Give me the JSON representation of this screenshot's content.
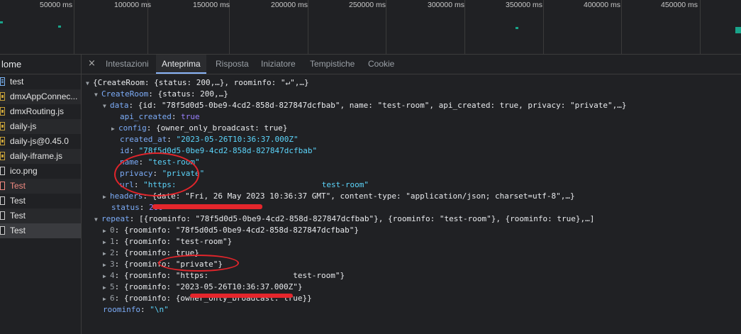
{
  "timeline": {
    "ticks": [
      "50000 ms",
      "100000 ms",
      "150000 ms",
      "200000 ms",
      "250000 ms",
      "300000 ms",
      "350000 ms",
      "400000 ms",
      "450000 ms"
    ]
  },
  "request_list": {
    "header": "Nome",
    "header_visible": "lome",
    "items": [
      {
        "label": "test",
        "icon": "document-icon"
      },
      {
        "label": "dmxAppConnec...",
        "icon": "script-file-icon"
      },
      {
        "label": "dmxRouting.js",
        "icon": "script-file-icon"
      },
      {
        "label": "daily-js",
        "icon": "script-file-icon"
      },
      {
        "label": "daily-js@0.45.0",
        "icon": "script-file-icon"
      },
      {
        "label": "daily-iframe.js",
        "icon": "script-file-icon"
      },
      {
        "label": "ico.png",
        "icon": "image-file-icon"
      },
      {
        "label": "Test",
        "icon": "error-file-icon"
      },
      {
        "label": "Test",
        "icon": "file-icon"
      },
      {
        "label": "Test",
        "icon": "file-icon"
      },
      {
        "label": "Test",
        "icon": "file-icon"
      }
    ]
  },
  "tabs": {
    "close": "×",
    "items": [
      "Intestazioni",
      "Anteprima",
      "Risposta",
      "Iniziatore",
      "Tempistiche",
      "Cookie"
    ],
    "active": "Anteprima"
  },
  "preview": {
    "l1": "{CreateRoom: {status: 200,…}, roominfo: \"↵\",…}",
    "l2_key": "CreateRoom",
    "l2_val": "{status: 200,…}",
    "l3_key": "data",
    "l3_val": "{id: \"78f5d0d5-0be9-4cd2-858d-827847dcfbab\", name: \"test-room\", api_created: true, privacy: \"private\",…}",
    "l4_key": "api_created",
    "l4_val": "true",
    "l5_key": "config",
    "l5_val": "{owner_only_broadcast: true}",
    "l6_key": "created_at",
    "l6_val": "\"2023-05-26T10:36:37.000Z\"",
    "l7_key": "id",
    "l7_val": "\"78f5d0d5-0be9-4cd2-858d-827847dcfbab\"",
    "l8_key": "name",
    "l8_val": "\"test-room\"",
    "l9_key": "privacy",
    "l9_val": "\"private\"",
    "l10_key": "url",
    "l10_val": "\"https:                               test-room\"",
    "l11_key": "headers",
    "l11_val": "{date: \"Fri, 26 May 2023 10:36:37 GMT\", content-type: \"application/json; charset=utf-8\",…}",
    "l12_key": "status",
    "l12_val": "200",
    "l13_key": "repeat",
    "l13_val": "[{roominfo: \"78f5d0d5-0be9-4cd2-858d-827847dcfbab\"}, {roominfo: \"test-room\"}, {roominfo: true},…]",
    "r0": "{roominfo: \"78f5d0d5-0be9-4cd2-858d-827847dcfbab\"}",
    "r1": "{roominfo: \"test-room\"}",
    "r2": "{roominfo: true}",
    "r3": "{roominfo: \"private\"}",
    "r4": "{roominfo: \"https:                  test-room\"}",
    "r5": "{roominfo: \"2023-05-26T10:36:37.000Z\"}",
    "r6": "{roominfo: {owner_only_broadcast: true}}",
    "l21_key": "roominfo",
    "l21_val": "\"\\n\""
  },
  "colors": {
    "background": "#202124",
    "annotation_red": "#e2252b",
    "active_tab_underline": "#8ab4f8"
  }
}
